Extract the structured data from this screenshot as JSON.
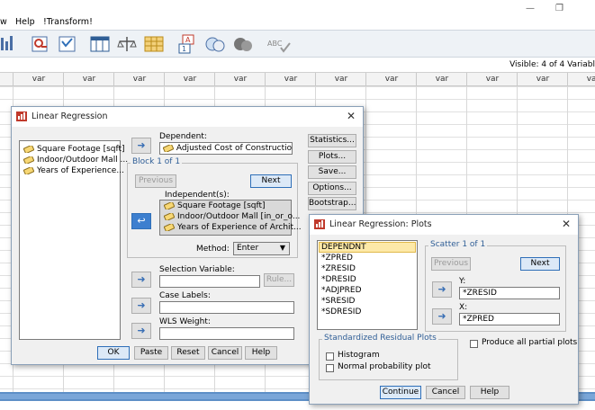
{
  "menubar": {
    "items": [
      "w",
      "Help",
      "!Transform!"
    ],
    "controls": [
      "minimize-glyph",
      "restore-glyph"
    ]
  },
  "toolbar": {
    "icons": [
      "statistics-icon",
      "find-icon",
      "weight-cases-icon",
      "split-file-icon",
      "select-cases-icon",
      "value-labels-icon",
      "sets-icon",
      "circle-icon",
      "spell-check-icon"
    ],
    "spell_text": "ABC"
  },
  "grid": {
    "visible_text": "Visible: 4 of 4 Variabl",
    "column_label": "var",
    "columns": 12
  },
  "linreg": {
    "title": "Linear Regression",
    "variables": [
      "Square Footage [sqft]",
      "Indoor/Outdoor Mall ...",
      "Years of Experience..."
    ],
    "dependent_label": "Dependent:",
    "dependent_value": "Adjusted Cost of Constructio...",
    "block_label": "Block 1 of 1",
    "previous": "Previous",
    "next": "Next",
    "independents_label": "Independent(s):",
    "independents": [
      "Square Footage [sqft]",
      "Indoor/Outdoor Mall [in_or_o...",
      "Years of Experience of Archit..."
    ],
    "method_label": "Method:",
    "method_value": "Enter",
    "selection_label": "Selection Variable:",
    "rule": "Rule...",
    "case_labels": "Case Labels:",
    "wls": "WLS Weight:",
    "side_buttons": [
      "Statistics...",
      "Plots...",
      "Save...",
      "Options...",
      "Bootstrap..."
    ],
    "bottom_buttons": [
      "OK",
      "Paste",
      "Reset",
      "Cancel",
      "Help"
    ]
  },
  "plots": {
    "title": "Linear Regression: Plots",
    "source": [
      "DEPENDNT",
      "*ZPRED",
      "*ZRESID",
      "*DRESID",
      "*ADJPRED",
      "*SRESID",
      "*SDRESID"
    ],
    "scatter_label": "Scatter 1 of 1",
    "previous": "Previous",
    "next": "Next",
    "y_label": "Y:",
    "y_value": "*ZRESID",
    "x_label": "X:",
    "x_value": "*ZPRED",
    "std_group": "Standardized Residual Plots",
    "histogram": "Histogram",
    "normal_plot": "Normal probability plot",
    "partial": "Produce all partial plots",
    "buttons": [
      "Continue",
      "Cancel",
      "Help"
    ]
  },
  "colors": {
    "accent": "#2f6fb8",
    "selection": "#3d7fcf",
    "highlight": "#fde9a8"
  }
}
